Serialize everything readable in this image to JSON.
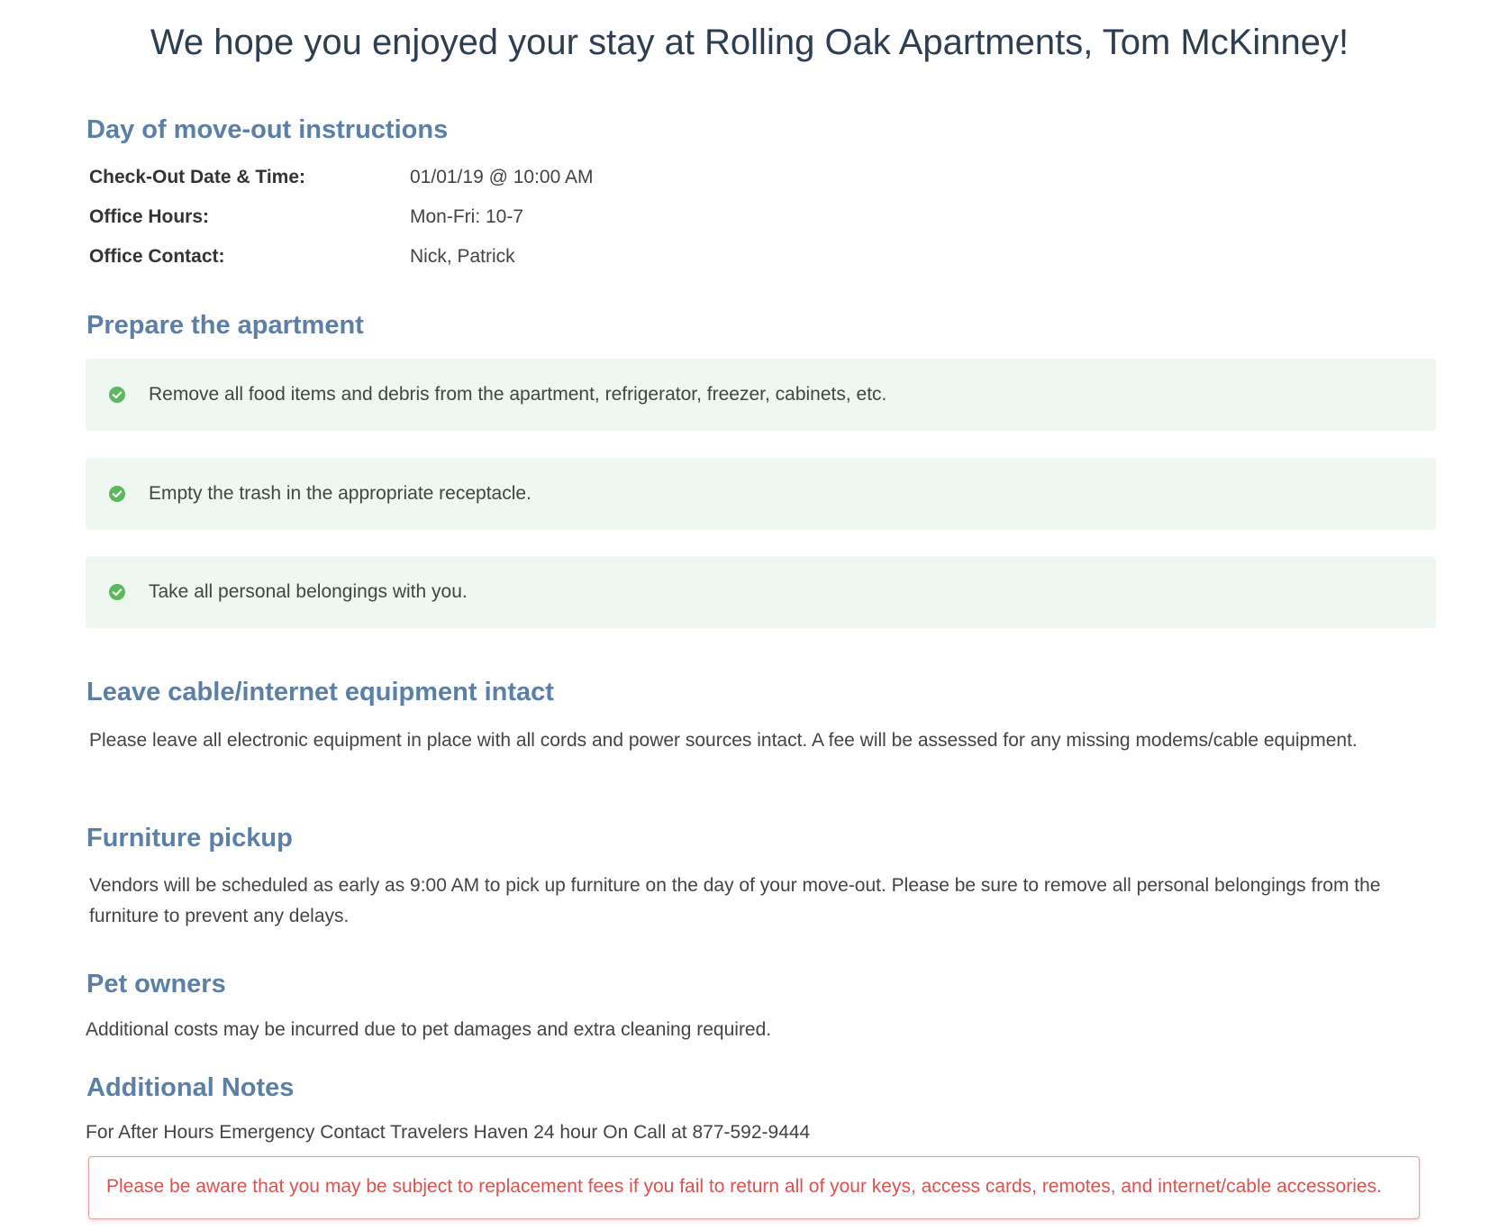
{
  "page_title": "We hope you enjoyed your stay at Rolling Oak Apartments, Tom McKinney!",
  "move_out": {
    "heading": "Day of move-out instructions",
    "rows": [
      {
        "label": "Check-Out Date & Time:",
        "value": "01/01/19 @ 10:00 AM"
      },
      {
        "label": "Office Hours:",
        "value": "Mon-Fri: 10-7"
      },
      {
        "label": "Office Contact:",
        "value": "Nick, Patrick"
      }
    ]
  },
  "prepare": {
    "heading": "Prepare the apartment",
    "icon": "check-circle-icon",
    "icon_color": "#5cb85c",
    "items": [
      "Remove all food items and debris from the apartment, refrigerator, freezer, cabinets, etc.",
      "Empty the trash in the appropriate receptacle.",
      "Take all personal belongings with you."
    ]
  },
  "cable": {
    "heading": "Leave cable/internet equipment intact",
    "body": "Please leave all electronic equipment in place with all cords and power sources intact. A fee will be assessed for any missing modems/cable equipment."
  },
  "furniture": {
    "heading": "Furniture pickup",
    "body": "Vendors will be scheduled as early as 9:00 AM to pick up furniture on the day of your move-out. Please be sure to remove all personal belongings from the furniture to prevent any delays."
  },
  "pets": {
    "heading": "Pet owners",
    "body": "Additional costs may be incurred due to pet damages and extra cleaning required."
  },
  "notes": {
    "heading": "Additional Notes",
    "body": "For After Hours Emergency Contact Travelers Haven 24 hour On Call at 877-592-9444"
  },
  "warning": {
    "text": "Please be aware that you may be subject to replacement fees if you fail to return all of your keys, access cards, remotes, and internet/cable accessories.",
    "color": "#d9534f"
  },
  "colors": {
    "heading": "#5b7fa6",
    "title": "#2c3e50",
    "check_bg": "#eef7f0"
  }
}
